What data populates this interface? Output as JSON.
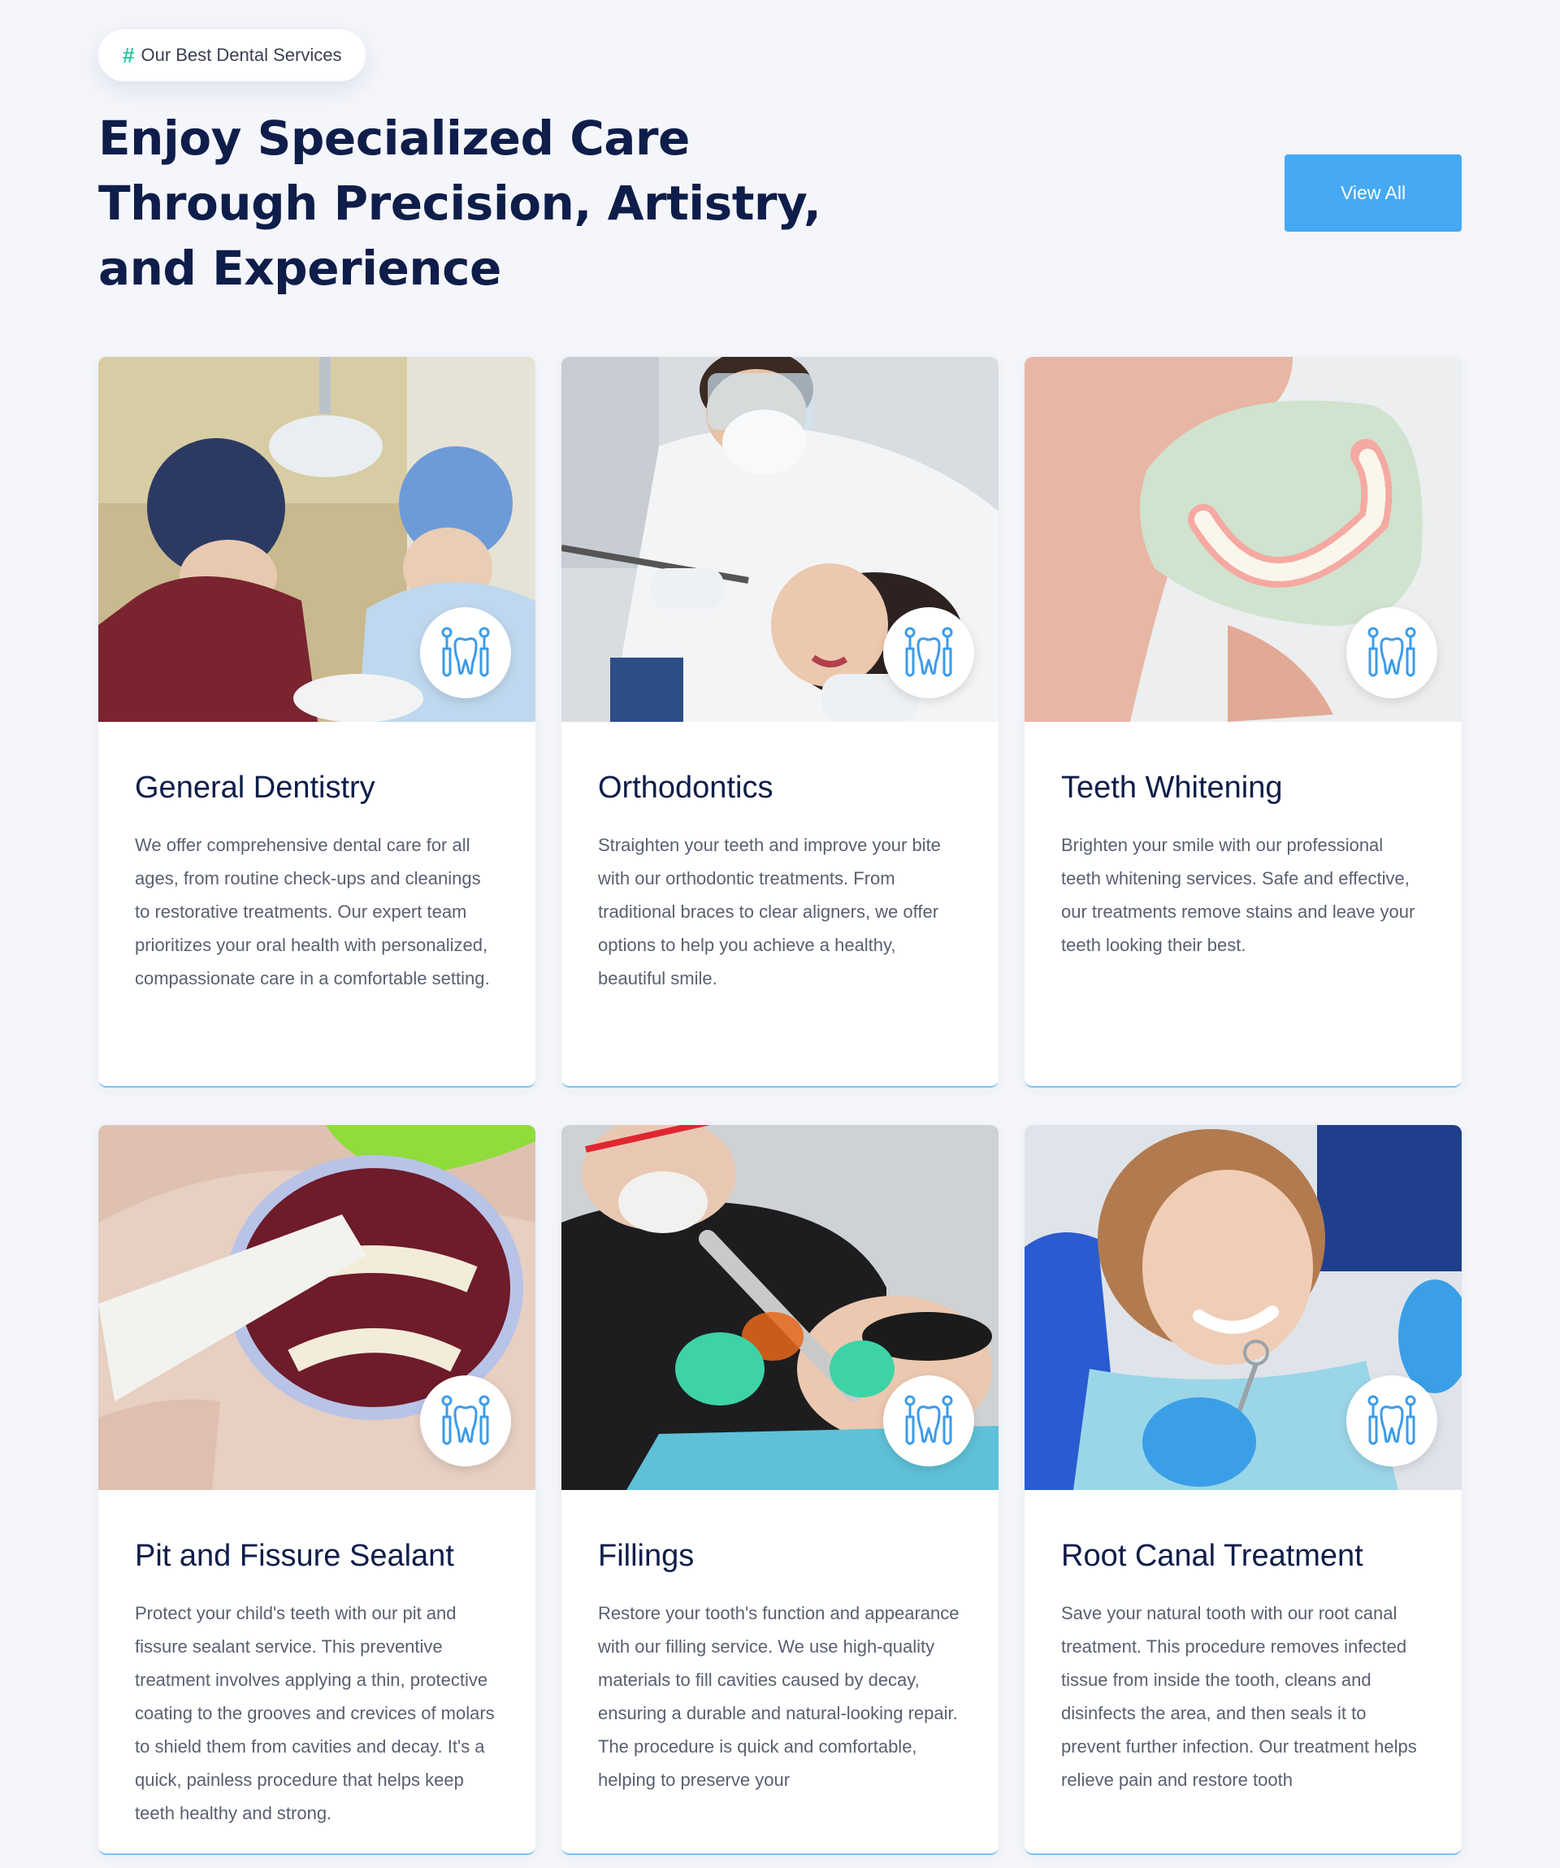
{
  "section": {
    "badge_label": "Our Best Dental Services",
    "headline": "Enjoy Specialized Care Through Precision, Artistry, and Experience",
    "view_all_label": "View All"
  },
  "colors": {
    "background": "#f4f6fb",
    "heading": "#0f1d4a",
    "accent_blue": "#45a9f3",
    "hash_green": "#2ec7a0",
    "icon_blue": "#3d9be9"
  },
  "services": [
    {
      "title": "General Dentistry",
      "description": "We offer comprehensive dental care for all ages, from routine check-ups and cleanings to restorative treatments. Our expert team prioritizes your oral health with personalized, compassionate care in a comfortable setting.",
      "icon": "dental-tools-tooth-icon"
    },
    {
      "title": "Orthodontics",
      "description": "Straighten your teeth and improve your bite with our orthodontic treatments. From traditional braces to clear aligners, we offer options to help you achieve a healthy, beautiful smile.",
      "icon": "dental-tools-tooth-icon"
    },
    {
      "title": "Teeth Whitening",
      "description": "Brighten your smile with our professional teeth whitening services. Safe and effective, our treatments remove stains and leave your teeth looking their best.",
      "icon": "dental-tools-tooth-icon"
    },
    {
      "title": "Pit and Fissure Sealant",
      "description": "Protect your child's teeth with our pit and fissure sealant service. This preventive treatment involves applying a thin, protective coating to the grooves and crevices of molars to shield them from cavities and decay. It's a quick, painless procedure that helps keep teeth healthy and strong.",
      "icon": "dental-tools-tooth-icon"
    },
    {
      "title": "Fillings",
      "description": "Restore your tooth's function and appearance with our filling service. We use high-quality materials to fill cavities caused by decay, ensuring a durable and natural-looking repair. The procedure is quick and comfortable, helping to preserve your",
      "icon": "dental-tools-tooth-icon"
    },
    {
      "title": "Root Canal Treatment",
      "description": "Save your natural tooth with our root canal treatment. This procedure removes infected tissue from inside the tooth, cleans and disinfects the area, and then seals it to prevent further infection. Our treatment helps relieve pain and restore tooth",
      "icon": "dental-tools-tooth-icon"
    }
  ]
}
